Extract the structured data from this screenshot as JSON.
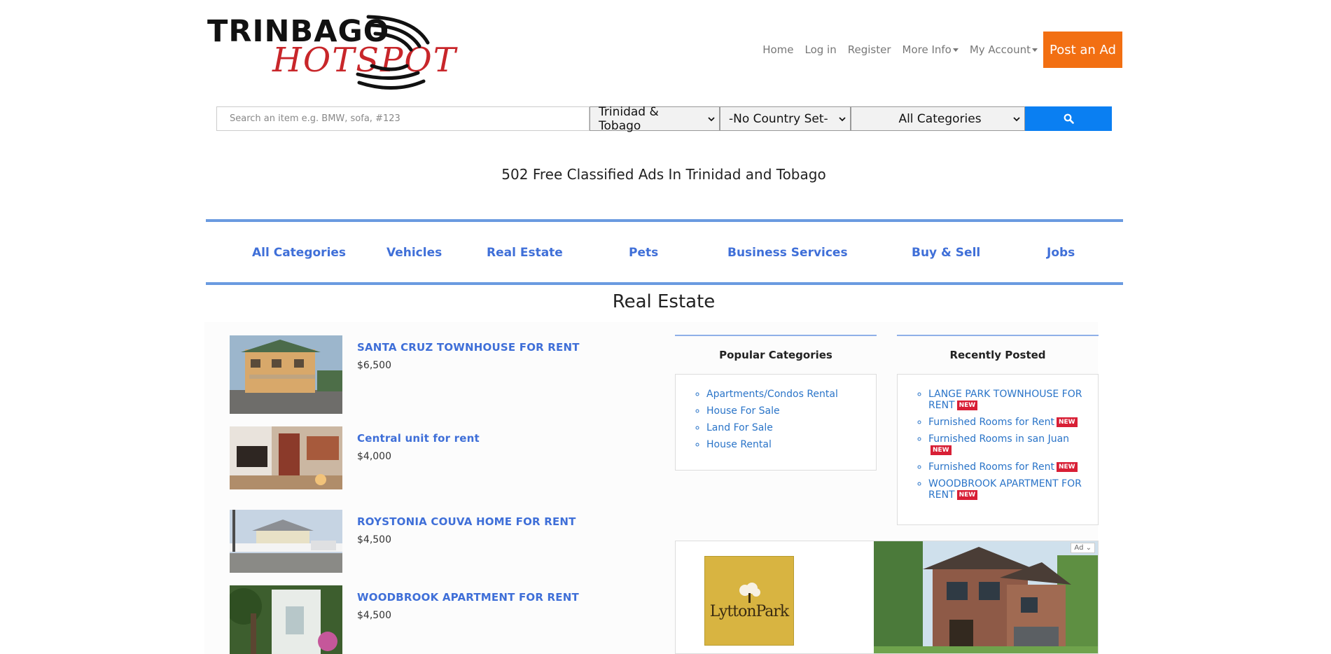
{
  "header": {
    "logo_top": "TRINBAGO",
    "logo_bottom": "HOTSPOT",
    "nav": {
      "home": "Home",
      "login": "Log in",
      "register": "Register",
      "more_info": "More Info",
      "my_account": "My Account",
      "post_ad": "Post an Ad"
    }
  },
  "search": {
    "placeholder": "Search an item e.g. BMW, sofa, #123",
    "country": "Trinidad & Tobago",
    "region": "-No Country Set-",
    "category": "All Categories",
    "button_icon": "search-icon"
  },
  "headline": "502 Free Classified Ads In Trinidad and Tobago",
  "categories": [
    "All Categories",
    "Vehicles",
    "Real Estate",
    "Pets",
    "Business Services",
    "Buy & Sell",
    "Jobs"
  ],
  "section_title": "Real Estate",
  "listings": [
    {
      "title": "SANTA CRUZ TOWNHOUSE FOR RENT",
      "price": "$6,500"
    },
    {
      "title": "Central unit for rent",
      "price": "$4,000"
    },
    {
      "title": "ROYSTONIA COUVA HOME FOR RENT",
      "price": "$4,500"
    },
    {
      "title": "WOODBROOK APARTMENT FOR RENT",
      "price": "$4,500"
    }
  ],
  "popular": {
    "title": "Popular Categories",
    "items": [
      "Apartments/Condos Rental",
      "House For Sale",
      "Land For Sale",
      "House Rental"
    ]
  },
  "recent": {
    "title": "Recently Posted",
    "new_label": "NEW",
    "items": [
      "LANGE PARK TOWNHOUSE FOR RENT",
      "Furnished Rooms for Rent",
      "Furnished Rooms in san Juan",
      "Furnished Rooms for Rent",
      "WOODBROOK APARTMENT FOR RENT"
    ]
  },
  "ad": {
    "brand": "LyttonPark",
    "badge": "Ad"
  },
  "colors": {
    "accent": "#f26f12",
    "link": "#3f6fd8",
    "search_button": "#0a7ff2",
    "rule": "#6a9ae0",
    "new_badge": "#d81f35"
  }
}
